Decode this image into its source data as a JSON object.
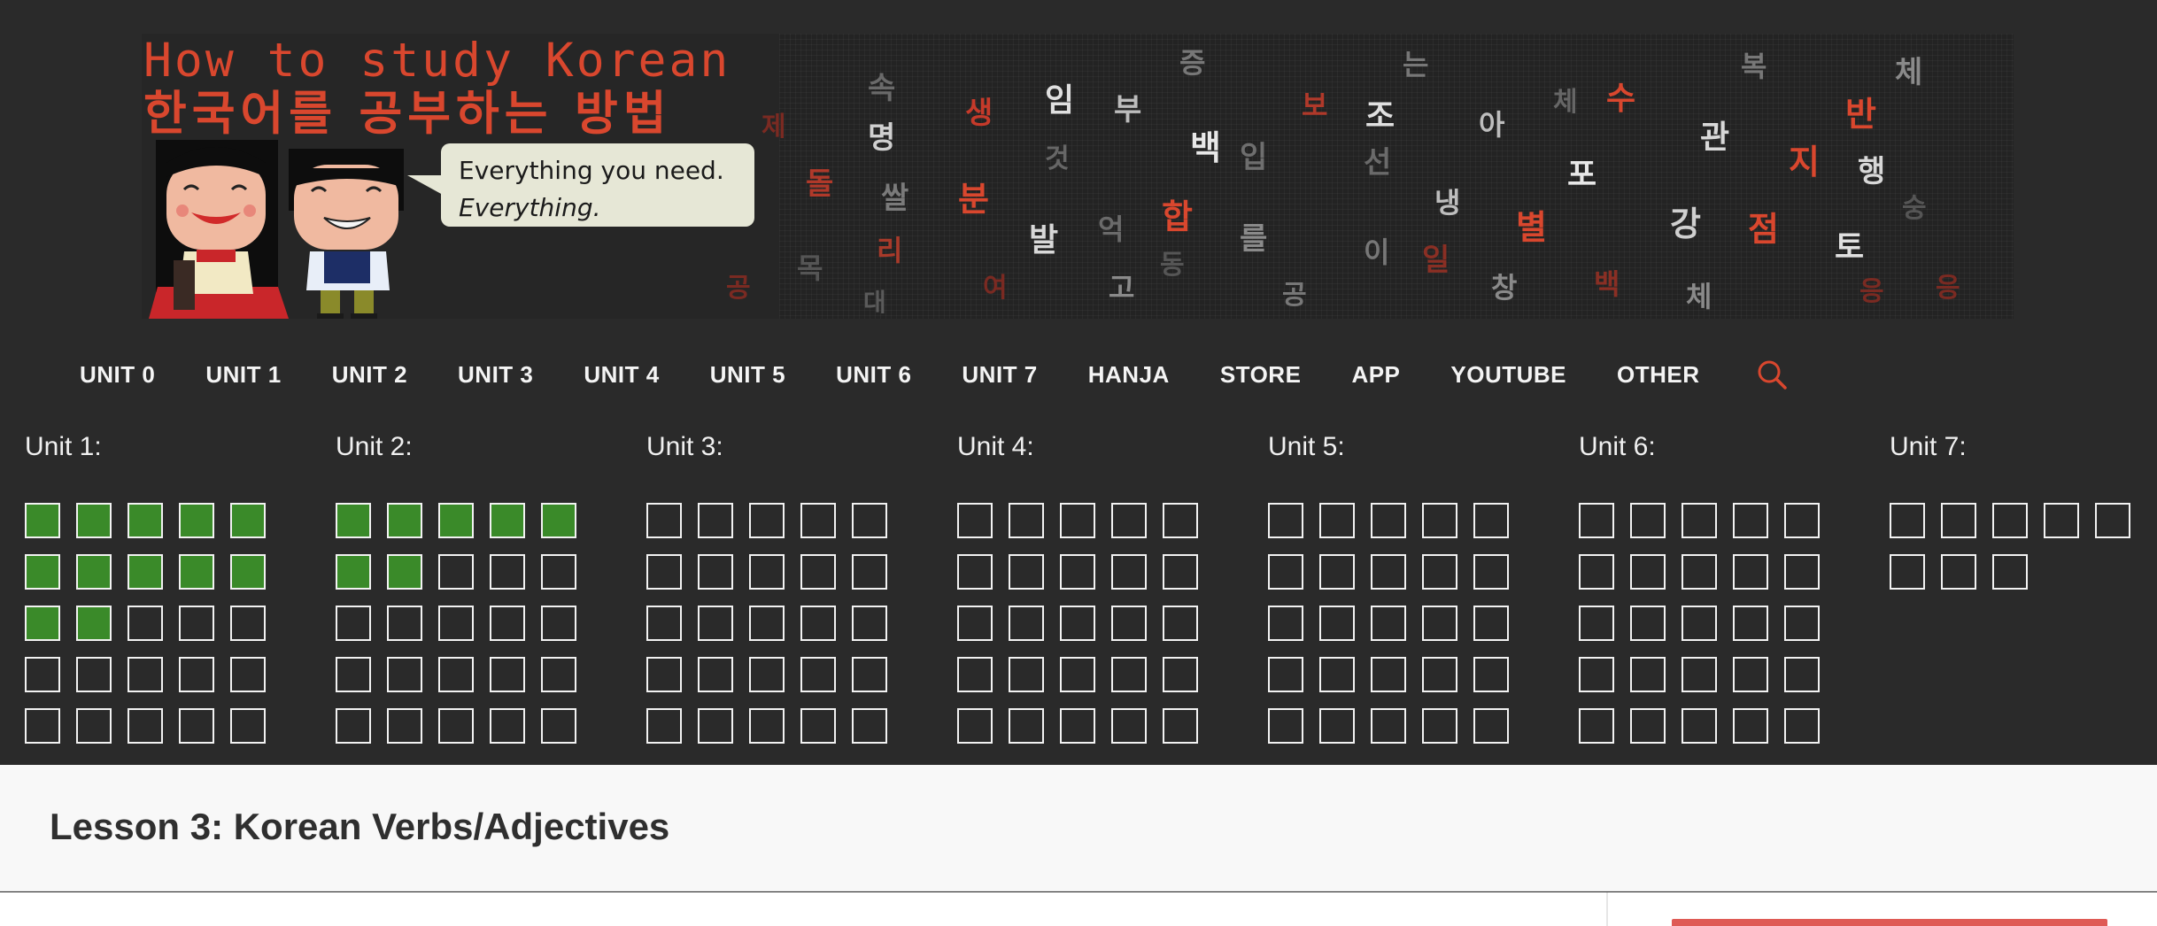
{
  "banner": {
    "title_en": "How to study Korean",
    "title_ko": "한국어를 공부하는 방법",
    "bubble_line1": "Everything you need.",
    "bubble_line2": "Everything.",
    "glyphs": [
      {
        "t": "속",
        "c": "#6a6a6a",
        "s": 34
      },
      {
        "t": "명",
        "c": "#cfcfcf",
        "s": 34
      },
      {
        "t": "쌀",
        "c": "#7a7a7a",
        "s": 34
      },
      {
        "t": "리",
        "c": "#a83a2a",
        "s": 32
      },
      {
        "t": "목",
        "c": "#555",
        "s": 32
      },
      {
        "t": "대",
        "c": "#5a5a5a",
        "s": 28
      },
      {
        "t": "제",
        "c": "#7a2a22",
        "s": 30
      },
      {
        "t": "돌",
        "c": "#b0392a",
        "s": 34
      },
      {
        "t": "공",
        "c": "#7a2a22",
        "s": 30
      },
      {
        "t": "생",
        "c": "#c53a2a",
        "s": 34
      },
      {
        "t": "분",
        "c": "#d9472e",
        "s": 38
      },
      {
        "t": "여",
        "c": "#7a2a22",
        "s": 30
      },
      {
        "t": "임",
        "c": "#e0e0e0",
        "s": 36
      },
      {
        "t": "것",
        "c": "#666",
        "s": 30
      },
      {
        "t": "발",
        "c": "#d8d8d8",
        "s": 36
      },
      {
        "t": "부",
        "c": "#bdbdbd",
        "s": 34
      },
      {
        "t": "억",
        "c": "#6a6a6a",
        "s": 32
      },
      {
        "t": "고",
        "c": "#8a8a8a",
        "s": 32
      },
      {
        "t": "증",
        "c": "#777",
        "s": 32
      },
      {
        "t": "백",
        "c": "#e8e8e8",
        "s": 38
      },
      {
        "t": "합",
        "c": "#d9472e",
        "s": 38
      },
      {
        "t": "동",
        "c": "#555",
        "s": 30
      },
      {
        "t": "입",
        "c": "#6e6e6e",
        "s": 34
      },
      {
        "t": "를",
        "c": "#8a8a8a",
        "s": 34
      },
      {
        "t": "공",
        "c": "#777",
        "s": 30
      },
      {
        "t": "보",
        "c": "#b0392a",
        "s": 32
      },
      {
        "t": "조",
        "c": "#e0e0e0",
        "s": 36
      },
      {
        "t": "선",
        "c": "#6a6a6a",
        "s": 34
      },
      {
        "t": "이",
        "c": "#777",
        "s": 32
      },
      {
        "t": "는",
        "c": "#777",
        "s": 32
      },
      {
        "t": "냉",
        "c": "#bdbdbd",
        "s": 32
      },
      {
        "t": "일",
        "c": "#8a2f24",
        "s": 34
      },
      {
        "t": "아",
        "c": "#bdbdbd",
        "s": 32
      },
      {
        "t": "창",
        "c": "#8a8a8a",
        "s": 32
      },
      {
        "t": "별",
        "c": "#d9472e",
        "s": 38
      },
      {
        "t": "체",
        "c": "#666",
        "s": 30
      },
      {
        "t": "수",
        "c": "#d9472e",
        "s": 36
      },
      {
        "t": "포",
        "c": "#e8e8e8",
        "s": 36
      },
      {
        "t": "백",
        "c": "#8a2f24",
        "s": 32
      },
      {
        "t": "강",
        "c": "#cfcfcf",
        "s": 38
      },
      {
        "t": "관",
        "c": "#d8d8d8",
        "s": 36
      },
      {
        "t": "점",
        "c": "#d9472e",
        "s": 38
      },
      {
        "t": "체",
        "c": "#8a8a8a",
        "s": 32
      },
      {
        "t": "복",
        "c": "#777",
        "s": 32
      },
      {
        "t": "지",
        "c": "#d9472e",
        "s": 38
      },
      {
        "t": "토",
        "c": "#e0e0e0",
        "s": 36
      },
      {
        "t": "반",
        "c": "#d9472e",
        "s": 38
      },
      {
        "t": "행",
        "c": "#d8d8d8",
        "s": 34
      },
      {
        "t": "숭",
        "c": "#555",
        "s": 30
      },
      {
        "t": "체",
        "c": "#8a8a8a",
        "s": 34
      },
      {
        "t": "응",
        "c": "#7a2a22",
        "s": 30
      },
      {
        "t": "응",
        "c": "#7a2a22",
        "s": 30
      }
    ]
  },
  "nav": {
    "items": [
      "UNIT 0",
      "UNIT 1",
      "UNIT 2",
      "UNIT 3",
      "UNIT 4",
      "UNIT 5",
      "UNIT 6",
      "UNIT 7",
      "HANJA",
      "STORE",
      "APP",
      "YOUTUBE",
      "OTHER"
    ]
  },
  "colors": {
    "accent": "#d9472e",
    "complete": "#3a8a29",
    "background": "#2a2a2a"
  },
  "progress": {
    "units": [
      {
        "title": "Unit 1:",
        "total": 25,
        "completed": 12
      },
      {
        "title": "Unit 2:",
        "total": 25,
        "completed": 7
      },
      {
        "title": "Unit 3:",
        "total": 25,
        "completed": 0
      },
      {
        "title": "Unit 4:",
        "total": 25,
        "completed": 0
      },
      {
        "title": "Unit 5:",
        "total": 25,
        "completed": 0
      },
      {
        "title": "Unit 6:",
        "total": 25,
        "completed": 0
      },
      {
        "title": "Unit 7:",
        "total": 8,
        "completed": 0
      }
    ]
  },
  "lesson": {
    "title": "Lesson 3: Korean Verbs/Adjectives"
  }
}
